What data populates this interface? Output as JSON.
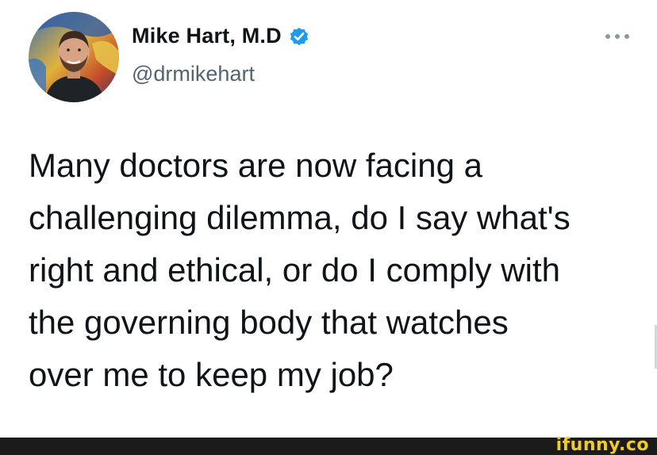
{
  "tweet": {
    "author": {
      "display_name": "Mike Hart, M.D",
      "handle": "@drmikehart",
      "verified": true
    },
    "body_lines": [
      "Many doctors are now facing a",
      "challenging dilemma, do I say what's",
      "right and ethical, or do I comply with",
      "the governing body that watches",
      "over me to keep my job?"
    ],
    "icons": {
      "verified": "verified-badge-icon",
      "more": "more-options-icon"
    }
  },
  "watermark": {
    "text": "ifunny.co"
  },
  "colors": {
    "name": "#0f1419",
    "handle": "#536471",
    "verified": "#1d9bf0",
    "footer": "#1b1b1b",
    "watermark": "#f5cb1d"
  }
}
